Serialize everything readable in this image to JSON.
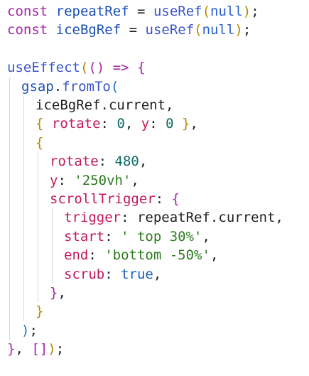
{
  "colors": {
    "keyword": "#a626a4",
    "variable": "#1a4fb8",
    "function": "#3a55c9",
    "property": "#c2185b",
    "number": "#0b6b62",
    "string": "#2d7a1f",
    "literal": "#2b5fd1",
    "bracket_level_1": "#b58900",
    "bracket_level_2": "#a626a4",
    "bracket_level_3": "#1e73c8",
    "text": "#1f1f1f",
    "background": "#ffffff",
    "indent_guide": "#d6d6d6"
  },
  "lines": [
    {
      "indent": 0,
      "tokens": [
        {
          "t": "const",
          "c": "kw"
        },
        {
          "t": " ",
          "c": "plain"
        },
        {
          "t": "repeatRef",
          "c": "var"
        },
        {
          "t": " = ",
          "c": "op"
        },
        {
          "t": "useRef",
          "c": "fn"
        },
        {
          "t": "(",
          "c": "b1"
        },
        {
          "t": "null",
          "c": "null"
        },
        {
          "t": ")",
          "c": "b1"
        },
        {
          "t": ";",
          "c": "plain"
        }
      ]
    },
    {
      "indent": 0,
      "tokens": [
        {
          "t": "const",
          "c": "kw"
        },
        {
          "t": " ",
          "c": "plain"
        },
        {
          "t": "iceBgRef",
          "c": "var"
        },
        {
          "t": " = ",
          "c": "op"
        },
        {
          "t": "useRef",
          "c": "fn"
        },
        {
          "t": "(",
          "c": "b1"
        },
        {
          "t": "null",
          "c": "null"
        },
        {
          "t": ")",
          "c": "b1"
        },
        {
          "t": ";",
          "c": "plain"
        }
      ]
    },
    {
      "indent": 0,
      "tokens": []
    },
    {
      "indent": 0,
      "tokens": [
        {
          "t": "useEffect",
          "c": "fn"
        },
        {
          "t": "(",
          "c": "b1"
        },
        {
          "t": "()",
          "c": "b2"
        },
        {
          "t": " => ",
          "c": "kw"
        },
        {
          "t": "{",
          "c": "b2"
        }
      ]
    },
    {
      "indent": 1,
      "tokens": [
        {
          "t": "gsap",
          "c": "var"
        },
        {
          "t": ".",
          "c": "plain"
        },
        {
          "t": "fromTo",
          "c": "fn"
        },
        {
          "t": "(",
          "c": "b3"
        }
      ]
    },
    {
      "indent": 2,
      "tokens": [
        {
          "t": "iceBgRef",
          "c": "plain"
        },
        {
          "t": ".",
          "c": "plain"
        },
        {
          "t": "current",
          "c": "plain"
        },
        {
          "t": ",",
          "c": "plain"
        }
      ]
    },
    {
      "indent": 2,
      "tokens": [
        {
          "t": "{",
          "c": "b1"
        },
        {
          "t": " ",
          "c": "plain"
        },
        {
          "t": "rotate",
          "c": "prop"
        },
        {
          "t": ": ",
          "c": "plain"
        },
        {
          "t": "0",
          "c": "num"
        },
        {
          "t": ", ",
          "c": "plain"
        },
        {
          "t": "y",
          "c": "prop"
        },
        {
          "t": ": ",
          "c": "plain"
        },
        {
          "t": "0",
          "c": "num"
        },
        {
          "t": " ",
          "c": "plain"
        },
        {
          "t": "}",
          "c": "b1"
        },
        {
          "t": ",",
          "c": "plain"
        }
      ]
    },
    {
      "indent": 2,
      "tokens": [
        {
          "t": "{",
          "c": "b1"
        }
      ]
    },
    {
      "indent": 3,
      "tokens": [
        {
          "t": "rotate",
          "c": "prop"
        },
        {
          "t": ": ",
          "c": "plain"
        },
        {
          "t": "480",
          "c": "num"
        },
        {
          "t": ",",
          "c": "plain"
        }
      ]
    },
    {
      "indent": 3,
      "tokens": [
        {
          "t": "y",
          "c": "prop"
        },
        {
          "t": ": ",
          "c": "plain"
        },
        {
          "t": "'250vh'",
          "c": "str"
        },
        {
          "t": ",",
          "c": "plain"
        }
      ]
    },
    {
      "indent": 3,
      "tokens": [
        {
          "t": "scrollTrigger",
          "c": "prop"
        },
        {
          "t": ": ",
          "c": "plain"
        },
        {
          "t": "{",
          "c": "b2"
        }
      ]
    },
    {
      "indent": 4,
      "tokens": [
        {
          "t": "trigger",
          "c": "prop"
        },
        {
          "t": ": ",
          "c": "plain"
        },
        {
          "t": "repeatRef",
          "c": "plain"
        },
        {
          "t": ".",
          "c": "plain"
        },
        {
          "t": "current",
          "c": "plain"
        },
        {
          "t": ",",
          "c": "plain"
        }
      ]
    },
    {
      "indent": 4,
      "tokens": [
        {
          "t": "start",
          "c": "prop"
        },
        {
          "t": ": ",
          "c": "plain"
        },
        {
          "t": "' top 30%'",
          "c": "str"
        },
        {
          "t": ",",
          "c": "plain"
        }
      ]
    },
    {
      "indent": 4,
      "tokens": [
        {
          "t": "end",
          "c": "prop"
        },
        {
          "t": ": ",
          "c": "plain"
        },
        {
          "t": "'bottom -50%'",
          "c": "str"
        },
        {
          "t": ",",
          "c": "plain"
        }
      ]
    },
    {
      "indent": 4,
      "tokens": [
        {
          "t": "scrub",
          "c": "prop"
        },
        {
          "t": ": ",
          "c": "plain"
        },
        {
          "t": "true",
          "c": "bool"
        },
        {
          "t": ",",
          "c": "plain"
        }
      ]
    },
    {
      "indent": 3,
      "tokens": [
        {
          "t": "}",
          "c": "b2"
        },
        {
          "t": ",",
          "c": "plain"
        }
      ]
    },
    {
      "indent": 2,
      "tokens": [
        {
          "t": "}",
          "c": "b1"
        }
      ]
    },
    {
      "indent": 1,
      "tokens": [
        {
          "t": ")",
          "c": "b3"
        },
        {
          "t": ";",
          "c": "plain"
        }
      ]
    },
    {
      "indent": 0,
      "tokens": [
        {
          "t": "}",
          "c": "b2"
        },
        {
          "t": ", ",
          "c": "plain"
        },
        {
          "t": "[]",
          "c": "b2"
        },
        {
          "t": ")",
          "c": "b1"
        },
        {
          "t": ";",
          "c": "plain"
        }
      ]
    }
  ]
}
